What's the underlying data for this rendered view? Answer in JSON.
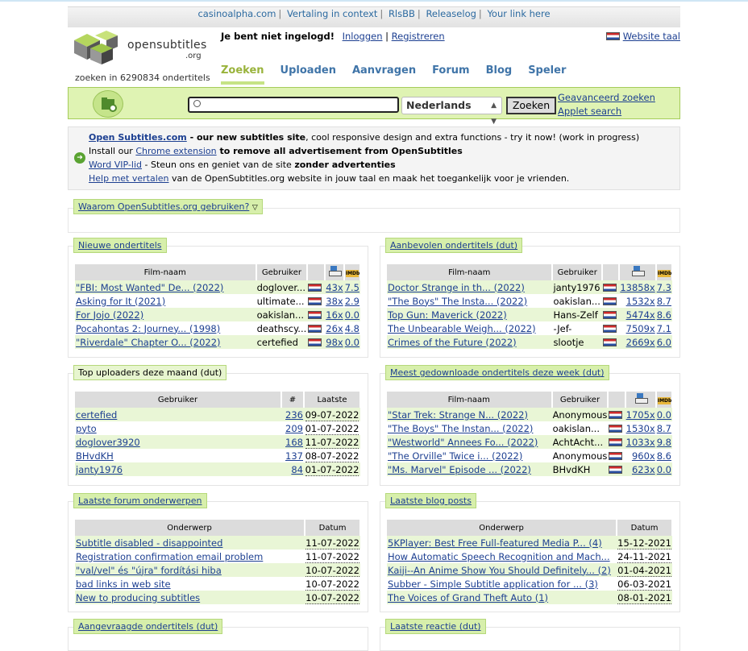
{
  "toplinks": [
    "casinoalpha.com",
    "Vertaling in context",
    "RlsBB",
    "Releaselog",
    "Your link here"
  ],
  "logo": {
    "text": "opensubtitles",
    "sub": ".org"
  },
  "subcount": "zoeken in 6290834 ondertitels",
  "login": {
    "status": "Je bent niet ingelogd!",
    "login": "Inloggen",
    "register": "Registreren",
    "sep": "|"
  },
  "sitelang": "Website taal",
  "nav": [
    "Zoeken",
    "Uploaden",
    "Aanvragen",
    "Forum",
    "Blog",
    "Speler"
  ],
  "search": {
    "language": "Nederlands",
    "button": "Zoeken",
    "advanced": "Geavanceerd zoeken",
    "applet": "Applet search"
  },
  "notice": {
    "l1_link": "Open Subtitles.com",
    "l1_bold": " - our new subtitles site",
    "l1_rest": ", cool responsive design and extra functions - try it now! (work in progress)",
    "l2_pre": "Install our ",
    "l2_link": "Chrome extension",
    "l2_bold": " to remove all advertisement from OpenSubtitles",
    "l3_link": "Word VIP-lid",
    "l3_mid": " - Steun ons en geniet van de site ",
    "l3_bold": "zonder advertenties",
    "l4_link": "Help met vertalen",
    "l4_rest": " van de OpenSubtitles.org website in jouw taal en maak het toegankelijk voor je vrienden."
  },
  "why": "Waarom OpenSubtitles.org gebruiken?",
  "new_subs": {
    "title": "Nieuwe ondertitels",
    "headers": [
      "Film-naam",
      "Gebruiker"
    ],
    "rows": [
      {
        "film": "\"FBI: Most Wanted\" De... (2022)",
        "user": "doglover...",
        "dl": "43x",
        "rating": "7.5"
      },
      {
        "film": "Asking for It (2021)",
        "user": "ultimate...",
        "dl": "38x",
        "rating": "2.9"
      },
      {
        "film": "For Jojo (2022)",
        "user": "oakislan...",
        "dl": "16x",
        "rating": "0.0"
      },
      {
        "film": "Pocahontas 2: Journey... (1998)",
        "user": "deathscy...",
        "dl": "26x",
        "rating": "4.8"
      },
      {
        "film": "\"Riverdale\" Chapter O... (2022)",
        "user": "certefied",
        "dl": "98x",
        "rating": "0.0"
      }
    ]
  },
  "recommended": {
    "title": "Aanbevolen ondertitels (dut)",
    "headers": [
      "Film-naam",
      "Gebruiker"
    ],
    "rows": [
      {
        "film": "Doctor Strange in th... (2022)",
        "user": "janty1976",
        "dl": "13858x",
        "rating": "7.3"
      },
      {
        "film": "\"The Boys\" The Insta... (2022)",
        "user": "oakislan...",
        "dl": "1532x",
        "rating": "8.7"
      },
      {
        "film": "Top Gun: Maverick (2022)",
        "user": "Hans-Zelf",
        "dl": "5474x",
        "rating": "8.6"
      },
      {
        "film": "The Unbearable Weigh... (2022)",
        "user": "-Jef-",
        "dl": "7509x",
        "rating": "7.1"
      },
      {
        "film": "Crimes of the Future (2022)",
        "user": "slootje",
        "dl": "2669x",
        "rating": "6.0"
      }
    ]
  },
  "uploaders": {
    "title": "Top uploaders deze maand (dut)",
    "headers": [
      "Gebruiker",
      "#",
      "Laatste"
    ],
    "rows": [
      {
        "user": "certefied",
        "count": "236",
        "last": "09-07-2022"
      },
      {
        "user": "pyto",
        "count": "209",
        "last": "01-07-2022"
      },
      {
        "user": "doglover3920",
        "count": "168",
        "last": "11-07-2022"
      },
      {
        "user": "BHvdKH",
        "count": "137",
        "last": "08-07-2022"
      },
      {
        "user": "janty1976",
        "count": "84",
        "last": "01-07-2022"
      }
    ]
  },
  "most_downloaded": {
    "title": "Meest gedownloade ondertitels deze week (dut)",
    "headers": [
      "Film-naam",
      "Gebruiker"
    ],
    "rows": [
      {
        "film": "\"Star Trek: Strange N... (2022)",
        "user": "Anonymous",
        "dl": "1705x",
        "rating": "0.0"
      },
      {
        "film": "\"The Boys\" The Instan... (2022)",
        "user": "oakislan...",
        "dl": "1530x",
        "rating": "8.7"
      },
      {
        "film": "\"Westworld\" Annees Fo... (2022)",
        "user": "AchtAcht...",
        "dl": "1033x",
        "rating": "9.8"
      },
      {
        "film": "\"The Orville\" Twice i... (2022)",
        "user": "Anonymous",
        "dl": "960x",
        "rating": "8.6"
      },
      {
        "film": "\"Ms. Marvel\" Episode ... (2022)",
        "user": "BHvdKH",
        "dl": "623x",
        "rating": "0.0"
      }
    ]
  },
  "forum": {
    "title": "Laatste forum onderwerpen",
    "headers": [
      "Onderwerp",
      "Datum"
    ],
    "rows": [
      {
        "topic": "Subtitle disabled - disappointed",
        "date": "11-07-2022"
      },
      {
        "topic": "Registration confirmation email problem",
        "date": "11-07-2022"
      },
      {
        "topic": "\"val/vel\" és \"újra\" fordítási hiba",
        "date": "10-07-2022"
      },
      {
        "topic": "bad links in web site",
        "date": "10-07-2022"
      },
      {
        "topic": "New to producing subtitles",
        "date": "10-07-2022"
      }
    ]
  },
  "blog": {
    "title": "Laatste blog posts",
    "headers": [
      "Onderwerp",
      "Datum"
    ],
    "rows": [
      {
        "topic": "5KPlayer: Best Free Full-featured Media P... (4)",
        "date": "15-12-2021"
      },
      {
        "topic": "How Automatic Speech Recognition and Mach...",
        "date": "24-11-2021"
      },
      {
        "topic": "Kaiji--An Anime Show You Should Definitely... (2)",
        "date": "01-04-2021"
      },
      {
        "topic": "Subber - Simple Subtitle application for ... (3)",
        "date": "06-03-2021"
      },
      {
        "topic": "The Voices of Grand Theft Auto (1)",
        "date": "08-01-2021"
      }
    ]
  },
  "requested": {
    "title": "Aangevraagde ondertitels (dut)"
  },
  "latest_reply": {
    "title": "Laatste reactie (dut)"
  },
  "imdb_label": "IMDb",
  "colors": {
    "accent_green": "#dff3b3",
    "row_green": "#e9f6d6",
    "link": "#1c3f91",
    "nav_active": "#99b33b"
  }
}
